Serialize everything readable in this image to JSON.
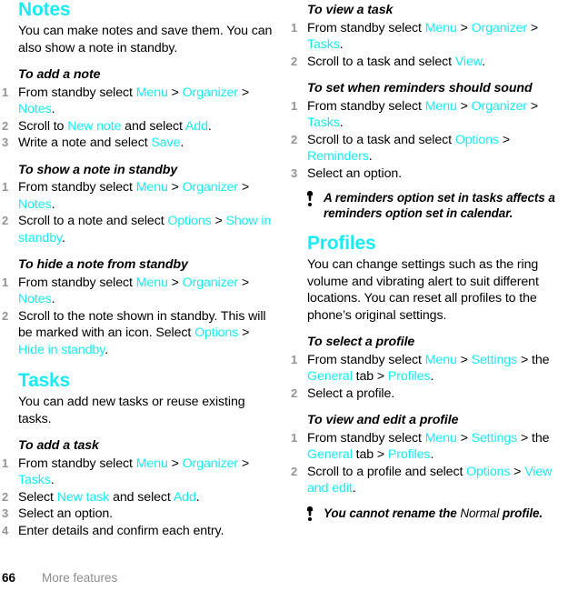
{
  "accent_color": "#16ecf7",
  "step_number_color": "#949494",
  "footer": {
    "page_number": "66",
    "chapter": "More features"
  },
  "left_column": {
    "section_heading": "Notes",
    "intro": "You can make notes and save them. You can also show a note in standby.",
    "procedures": [
      {
        "title": "To add a note",
        "steps": [
          {
            "num": "1",
            "parts": [
              {
                "t": "From standby select ",
                "hl": false
              },
              {
                "t": "Menu",
                "hl": true
              },
              {
                "t": " > ",
                "hl": false
              },
              {
                "t": "Organizer",
                "hl": true
              },
              {
                "t": " > ",
                "hl": false
              },
              {
                "t": "Notes",
                "hl": true
              },
              {
                "t": ".",
                "hl": false
              }
            ]
          },
          {
            "num": "2",
            "parts": [
              {
                "t": "Scroll to ",
                "hl": false
              },
              {
                "t": "New note",
                "hl": true
              },
              {
                "t": " and select ",
                "hl": false
              },
              {
                "t": "Add",
                "hl": true
              },
              {
                "t": ".",
                "hl": false
              }
            ]
          },
          {
            "num": "3",
            "parts": [
              {
                "t": "Write a note and select ",
                "hl": false
              },
              {
                "t": "Save",
                "hl": true
              },
              {
                "t": ".",
                "hl": false
              }
            ]
          }
        ]
      },
      {
        "title": "To show a note in standby",
        "steps": [
          {
            "num": "1",
            "parts": [
              {
                "t": "From standby select ",
                "hl": false
              },
              {
                "t": "Menu",
                "hl": true
              },
              {
                "t": " > ",
                "hl": false
              },
              {
                "t": "Organizer",
                "hl": true
              },
              {
                "t": " > ",
                "hl": false
              },
              {
                "t": "Notes",
                "hl": true
              },
              {
                "t": ".",
                "hl": false
              }
            ]
          },
          {
            "num": "2",
            "parts": [
              {
                "t": "Scroll to a note and select ",
                "hl": false
              },
              {
                "t": "Options",
                "hl": true
              },
              {
                "t": " > ",
                "hl": false
              },
              {
                "t": "Show in standby",
                "hl": true
              },
              {
                "t": ".",
                "hl": false
              }
            ]
          }
        ]
      },
      {
        "title": "To hide a note from standby",
        "steps": [
          {
            "num": "1",
            "parts": [
              {
                "t": "From standby select ",
                "hl": false
              },
              {
                "t": "Menu",
                "hl": true
              },
              {
                "t": " > ",
                "hl": false
              },
              {
                "t": "Organizer",
                "hl": true
              },
              {
                "t": " > ",
                "hl": false
              },
              {
                "t": "Notes",
                "hl": true
              },
              {
                "t": ".",
                "hl": false
              }
            ]
          },
          {
            "num": "2",
            "parts": [
              {
                "t": "Scroll to the note shown in standby. This will be marked with an icon. Select ",
                "hl": false
              },
              {
                "t": "Options",
                "hl": true
              },
              {
                "t": " > ",
                "hl": false
              },
              {
                "t": "Hide in standby",
                "hl": true
              },
              {
                "t": ".",
                "hl": false
              }
            ]
          }
        ]
      }
    ],
    "section_heading_2": "Tasks",
    "intro_2": "You can add new tasks or reuse existing tasks.",
    "procedures_2": [
      {
        "title": "To add a task",
        "steps": [
          {
            "num": "1",
            "parts": [
              {
                "t": "From standby select ",
                "hl": false
              },
              {
                "t": "Menu",
                "hl": true
              },
              {
                "t": " > ",
                "hl": false
              },
              {
                "t": "Organizer",
                "hl": true
              },
              {
                "t": " > ",
                "hl": false
              },
              {
                "t": "Tasks",
                "hl": true
              },
              {
                "t": ".",
                "hl": false
              }
            ]
          },
          {
            "num": "2",
            "parts": [
              {
                "t": "Select ",
                "hl": false
              },
              {
                "t": "New task",
                "hl": true
              },
              {
                "t": " and select ",
                "hl": false
              },
              {
                "t": "Add",
                "hl": true
              },
              {
                "t": ".",
                "hl": false
              }
            ]
          },
          {
            "num": "3",
            "parts": [
              {
                "t": "Select an option.",
                "hl": false
              }
            ]
          },
          {
            "num": "4",
            "parts": [
              {
                "t": "Enter details and confirm each entry.",
                "hl": false
              }
            ]
          }
        ]
      }
    ]
  },
  "right_column": {
    "procedures": [
      {
        "title": "To view a task",
        "steps": [
          {
            "num": "1",
            "parts": [
              {
                "t": "From standby select ",
                "hl": false
              },
              {
                "t": "Menu",
                "hl": true
              },
              {
                "t": " > ",
                "hl": false
              },
              {
                "t": "Organizer",
                "hl": true
              },
              {
                "t": " > ",
                "hl": false
              },
              {
                "t": "Tasks",
                "hl": true
              },
              {
                "t": ".",
                "hl": false
              }
            ]
          },
          {
            "num": "2",
            "parts": [
              {
                "t": "Scroll to a task and select ",
                "hl": false
              },
              {
                "t": "View",
                "hl": true
              },
              {
                "t": ".",
                "hl": false
              }
            ]
          }
        ]
      },
      {
        "title": "To set when reminders should sound",
        "steps": [
          {
            "num": "1",
            "parts": [
              {
                "t": "From standby select ",
                "hl": false
              },
              {
                "t": "Menu",
                "hl": true
              },
              {
                "t": " > ",
                "hl": false
              },
              {
                "t": "Organizer",
                "hl": true
              },
              {
                "t": " > ",
                "hl": false
              },
              {
                "t": "Tasks",
                "hl": true
              },
              {
                "t": ".",
                "hl": false
              }
            ]
          },
          {
            "num": "2",
            "parts": [
              {
                "t": "Scroll to a task and select ",
                "hl": false
              },
              {
                "t": "Options",
                "hl": true
              },
              {
                "t": " > ",
                "hl": false
              },
              {
                "t": "Reminders",
                "hl": true
              },
              {
                "t": ".",
                "hl": false
              }
            ]
          },
          {
            "num": "3",
            "parts": [
              {
                "t": "Select an option.",
                "hl": false
              }
            ]
          }
        ]
      }
    ],
    "tip_1": "A reminders option set in tasks affects a reminders option set in calendar.",
    "section_heading": "Profiles",
    "intro": "You can change settings such as the ring volume and vibrating alert to suit different locations. You can reset all profiles to the phone’s original settings.",
    "procedures_2": [
      {
        "title": "To select a profile",
        "steps": [
          {
            "num": "1",
            "parts": [
              {
                "t": "From standby select ",
                "hl": false
              },
              {
                "t": "Menu",
                "hl": true
              },
              {
                "t": " > ",
                "hl": false
              },
              {
                "t": "Settings",
                "hl": true
              },
              {
                "t": " > the ",
                "hl": false
              },
              {
                "t": "General",
                "hl": true
              },
              {
                "t": " tab > ",
                "hl": false
              },
              {
                "t": "Profiles",
                "hl": true
              },
              {
                "t": ".",
                "hl": false
              }
            ]
          },
          {
            "num": "2",
            "parts": [
              {
                "t": "Select a profile.",
                "hl": false
              }
            ]
          }
        ]
      },
      {
        "title": "To view and edit a profile",
        "steps": [
          {
            "num": "1",
            "parts": [
              {
                "t": "From standby select ",
                "hl": false
              },
              {
                "t": "Menu",
                "hl": true
              },
              {
                "t": " > ",
                "hl": false
              },
              {
                "t": "Settings",
                "hl": true
              },
              {
                "t": " > the ",
                "hl": false
              },
              {
                "t": "General",
                "hl": true
              },
              {
                "t": " tab > ",
                "hl": false
              },
              {
                "t": "Profiles",
                "hl": true
              },
              {
                "t": ".",
                "hl": false
              }
            ]
          },
          {
            "num": "2",
            "parts": [
              {
                "t": "Scroll to a profile and select ",
                "hl": false
              },
              {
                "t": "Options",
                "hl": true
              },
              {
                "t": " > ",
                "hl": false
              },
              {
                "t": "View and edit",
                "hl": true
              },
              {
                "t": ".",
                "hl": false
              }
            ]
          }
        ]
      }
    ],
    "tip_2_parts": [
      {
        "t": "You cannot rename the ",
        "reg": false
      },
      {
        "t": "Normal",
        "reg": true
      },
      {
        "t": " profile.",
        "reg": false
      }
    ]
  }
}
